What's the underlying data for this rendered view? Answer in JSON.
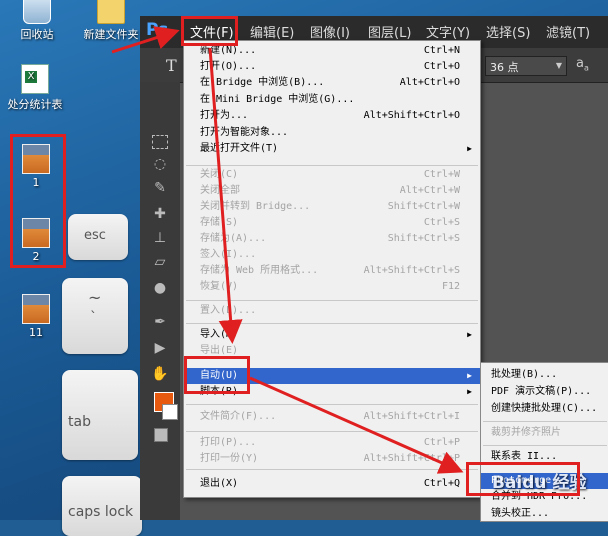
{
  "desktop": {
    "icons": [
      {
        "label": "回收站"
      },
      {
        "label": "新建文件夹"
      },
      {
        "label": "处分统计表"
      },
      {
        "label": "1"
      },
      {
        "label": "2"
      },
      {
        "label": "11"
      }
    ],
    "keys": {
      "esc": "esc",
      "tilde": "~",
      "backtick": "`",
      "tab": "tab",
      "caps": "caps lock"
    }
  },
  "ps": {
    "logo": "Ps",
    "menubar": [
      "文件(F)",
      "编辑(E)",
      "图像(I)",
      "图层(L)",
      "文字(Y)",
      "选择(S)",
      "滤镜(T)"
    ],
    "options": {
      "font_size": "36 点",
      "aa": "a",
      "aa_sub": "a"
    }
  },
  "file_menu": {
    "items": [
      {
        "label": "新建(N)...",
        "shortcut": "Ctrl+N"
      },
      {
        "label": "打开(O)...",
        "shortcut": "Ctrl+O"
      },
      {
        "label": "在 Bridge 中浏览(B)...",
        "shortcut": "Alt+Ctrl+O"
      },
      {
        "label": "在 Mini Bridge 中浏览(G)...",
        "shortcut": ""
      },
      {
        "label": "打开为...",
        "shortcut": "Alt+Shift+Ctrl+O"
      },
      {
        "label": "打开为智能对象...",
        "shortcut": ""
      },
      {
        "label": "最近打开文件(T)",
        "shortcut": ""
      },
      {
        "label": "关闭(C)",
        "shortcut": "Ctrl+W"
      },
      {
        "label": "关闭全部",
        "shortcut": "Alt+Ctrl+W"
      },
      {
        "label": "关闭并转到 Bridge...",
        "shortcut": "Shift+Ctrl+W"
      },
      {
        "label": "存储(S)",
        "shortcut": "Ctrl+S"
      },
      {
        "label": "存储为(A)...",
        "shortcut": "Shift+Ctrl+S"
      },
      {
        "label": "签入(I)...",
        "shortcut": ""
      },
      {
        "label": "存储为 Web 所用格式...",
        "shortcut": "Alt+Shift+Ctrl+S"
      },
      {
        "label": "恢复(V)",
        "shortcut": "F12"
      },
      {
        "label": "置入(L)...",
        "shortcut": ""
      },
      {
        "label": "导入(M)",
        "shortcut": ""
      },
      {
        "label": "导出(E)",
        "shortcut": ""
      },
      {
        "label": "自动(U)",
        "shortcut": ""
      },
      {
        "label": "脚本(R)",
        "shortcut": ""
      },
      {
        "label": "文件简介(F)...",
        "shortcut": "Alt+Shift+Ctrl+I"
      },
      {
        "label": "打印(P)...",
        "shortcut": "Ctrl+P"
      },
      {
        "label": "打印一份(Y)",
        "shortcut": "Alt+Shift+Ctrl+P"
      },
      {
        "label": "退出(X)",
        "shortcut": "Ctrl+Q"
      }
    ]
  },
  "auto_submenu": {
    "items": [
      {
        "label": "批处理(B)..."
      },
      {
        "label": "PDF 演示文稿(P)..."
      },
      {
        "label": "创建快捷批处理(C)..."
      },
      {
        "label": "裁剪并修齐照片"
      },
      {
        "label": "联系表 II..."
      },
      {
        "label": "Photomerge..."
      },
      {
        "label": "合并到 HDR Pro..."
      },
      {
        "label": "镜头校正..."
      }
    ]
  },
  "watermark": {
    "text": "Baidu 经验"
  },
  "colors": {
    "highlight": "#3366cc",
    "annotation_red": "#e02020",
    "ps_dark": "#2b2b2b"
  }
}
